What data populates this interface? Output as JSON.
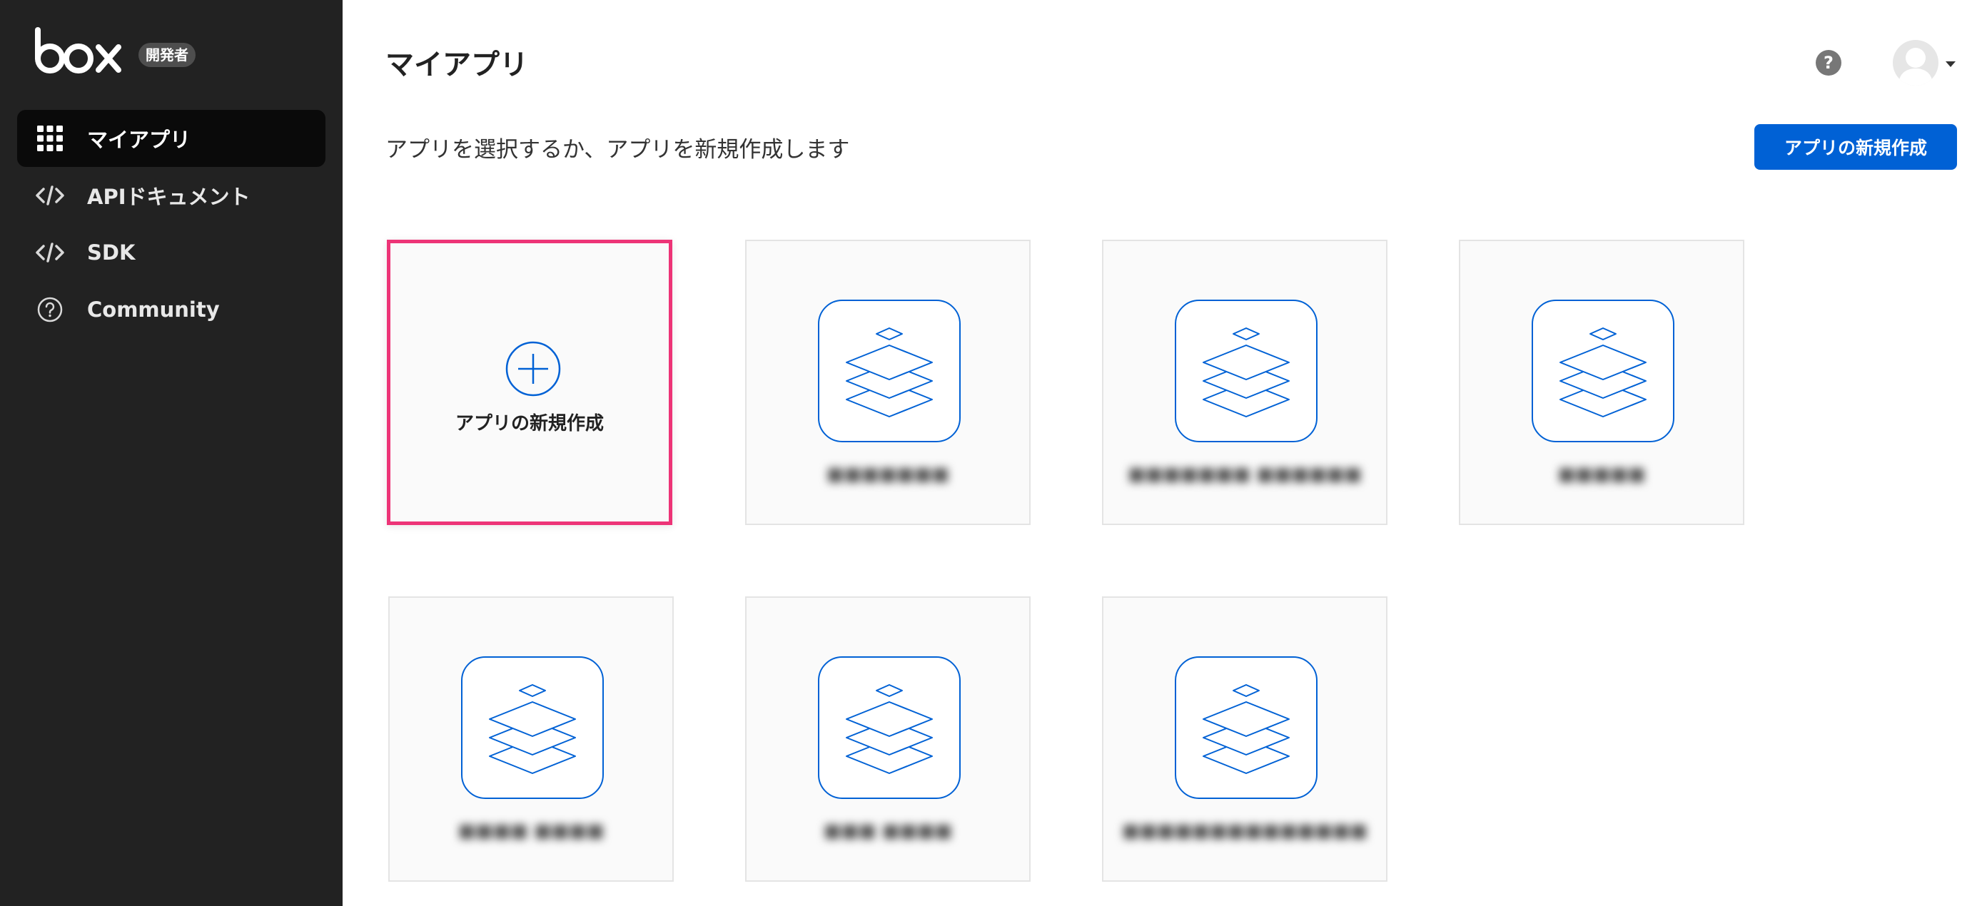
{
  "brand": {
    "logo_text": "box",
    "badge": "開発者"
  },
  "sidebar": {
    "items": [
      {
        "label": "マイアプリ",
        "icon": "grid-icon",
        "active": true
      },
      {
        "label": "APIドキュメント",
        "icon": "code-icon",
        "active": false
      },
      {
        "label": "SDK",
        "icon": "code-icon",
        "active": false
      },
      {
        "label": "Community",
        "icon": "help-circle-icon",
        "active": false
      }
    ]
  },
  "header": {
    "title": "マイアプリ",
    "subtitle": "アプリを選択するか、アプリを新規作成します",
    "help_label": "?",
    "create_button": "アプリの新規作成"
  },
  "cards": {
    "new_card_label": "アプリの新規作成",
    "apps": [
      {
        "name": "■■■■■■■",
        "icon": "stacked-layers-icon"
      },
      {
        "name": "■■■■■■■ ■■■■■■",
        "icon": "stacked-layers-icon"
      },
      {
        "name": "■■■■■",
        "icon": "stacked-layers-icon"
      },
      {
        "name": "■■■■ ■■■■",
        "icon": "stacked-layers-icon"
      },
      {
        "name": "■■■ ■■■■",
        "icon": "stacked-layers-icon"
      },
      {
        "name": "■■■■■■■■■■■■■■",
        "icon": "stacked-layers-icon"
      }
    ]
  },
  "colors": {
    "sidebar_bg": "#222222",
    "accent": "#0061d5",
    "highlight": "#ed3477"
  }
}
